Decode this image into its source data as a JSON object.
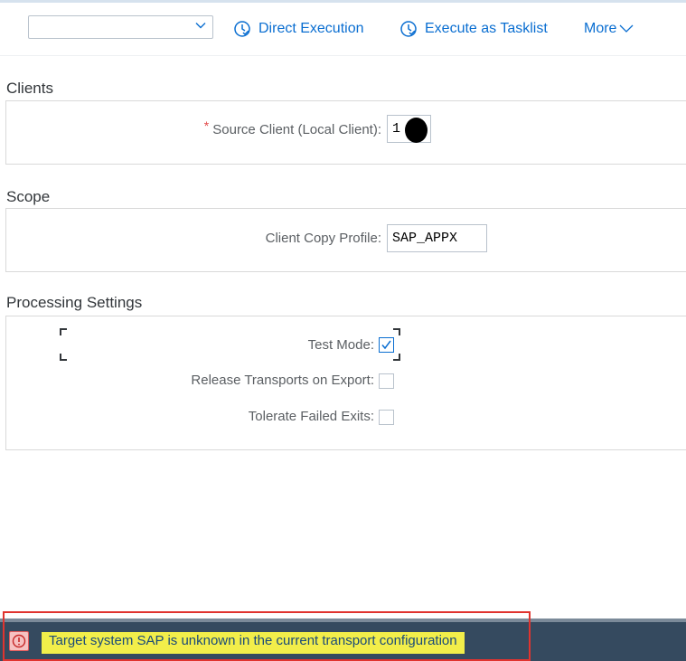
{
  "toolbar": {
    "variant_value": "",
    "direct_execution_label": "Direct Execution",
    "execute_tasklist_label": "Execute as Tasklist",
    "more_label": "More",
    "accent_color": "#0a6ed1"
  },
  "sections": {
    "clients": {
      "title": "Clients",
      "source_client_label": "Source Client (Local Client):",
      "required_mark": "*",
      "source_client_value": "1"
    },
    "scope": {
      "title": "Scope",
      "client_copy_profile_label": "Client Copy Profile:",
      "client_copy_profile_value": "SAP_APPX"
    },
    "processing": {
      "title": "Processing Settings",
      "test_mode_label": "Test Mode:",
      "test_mode_checked": true,
      "release_transports_label": "Release Transports on Export:",
      "release_transports_checked": false,
      "tolerate_failed_exits_label": "Tolerate Failed Exits:",
      "tolerate_failed_exits_checked": false
    }
  },
  "message_bar": {
    "icon": "error-circle-icon",
    "text": "Target system SAP is unknown in the current transport configuration"
  }
}
